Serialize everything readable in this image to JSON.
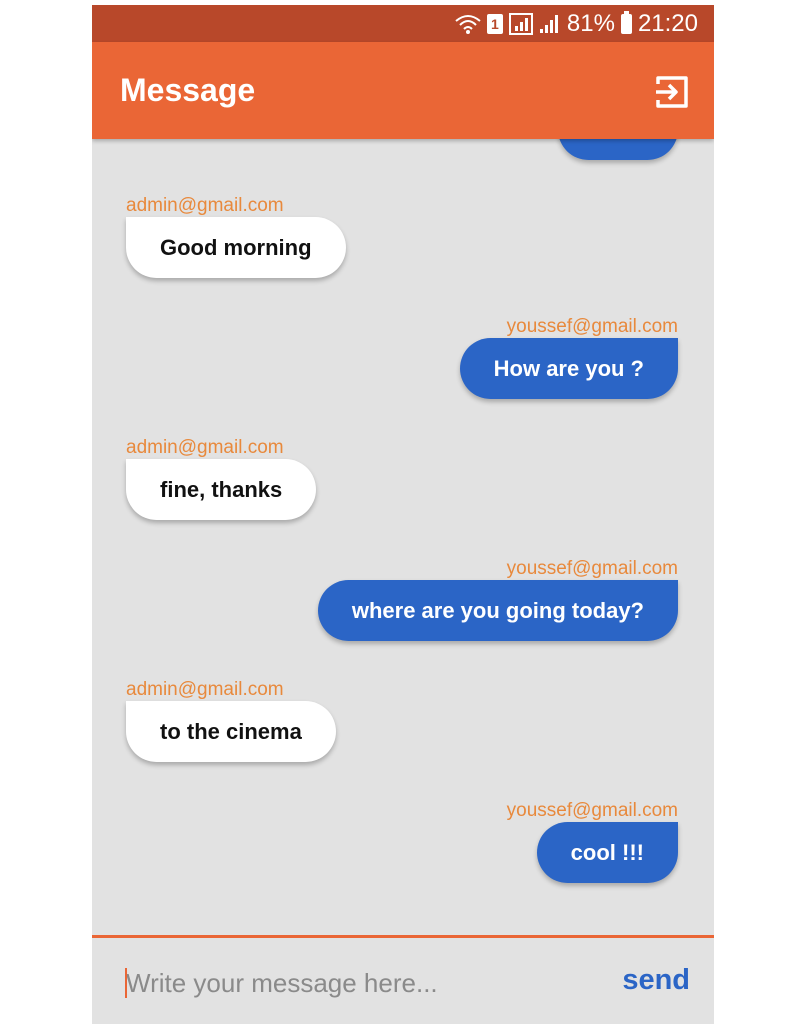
{
  "status_bar": {
    "sim_slot": "1",
    "battery": "81%",
    "time": "21:20"
  },
  "appbar": {
    "title": "Message",
    "action_icon": "logout-icon"
  },
  "messages": [
    {
      "sender": "admin@gmail.com",
      "text": "Good morning",
      "side": "left"
    },
    {
      "sender": "youssef@gmail.com",
      "text": "How are you ?",
      "side": "right"
    },
    {
      "sender": "admin@gmail.com",
      "text": "fine, thanks",
      "side": "left"
    },
    {
      "sender": "youssef@gmail.com",
      "text": "where are you going today?",
      "side": "right"
    },
    {
      "sender": "admin@gmail.com",
      "text": "to the cinema",
      "side": "left"
    },
    {
      "sender": "youssef@gmail.com",
      "text": "cool !!!",
      "side": "right"
    }
  ],
  "composer": {
    "placeholder": "Write your message here...",
    "value": "",
    "send_label": "send"
  },
  "colors": {
    "status_bar": "#b8482a",
    "app_bar": "#ea6636",
    "outgoing_bubble": "#2b65c6",
    "incoming_bubble": "#ffffff",
    "sender_label": "#e8893c",
    "background": "#e2e2e2"
  }
}
